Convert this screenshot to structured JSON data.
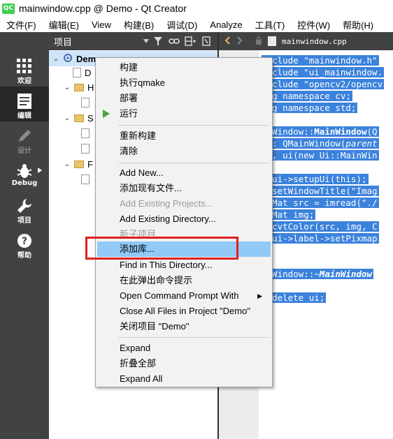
{
  "window": {
    "logo_text": "QC",
    "title": "mainwindow.cpp @ Demo - Qt Creator"
  },
  "menubar": [
    "文件(F)",
    "编辑(E)",
    "View",
    "构建(B)",
    "调试(D)",
    "Analyze",
    "工具(T)",
    "控件(W)",
    "帮助(H)"
  ],
  "modes": [
    {
      "label": "欢迎",
      "icon": "grid-icon"
    },
    {
      "label": "编辑",
      "icon": "edit-document-icon"
    },
    {
      "label": "设计",
      "icon": "pencil-icon"
    },
    {
      "label": "Debug",
      "icon": "bug-icon"
    },
    {
      "label": "项目",
      "icon": "wrench-icon"
    },
    {
      "label": "帮助",
      "icon": "help-icon"
    }
  ],
  "project_pane": {
    "title": "项目"
  },
  "tree": [
    {
      "text": "Demo",
      "type": "project"
    },
    {
      "text": "D",
      "type": "file"
    },
    {
      "text": "H",
      "type": "folder"
    },
    {
      "text": "",
      "type": "file"
    },
    {
      "text": "S",
      "type": "folder"
    },
    {
      "text": "",
      "type": "file"
    },
    {
      "text": "",
      "type": "file"
    },
    {
      "text": "F",
      "type": "folder"
    },
    {
      "text": "",
      "type": "file"
    }
  ],
  "editor": {
    "tab_title": "mainwindow.cpp",
    "lines": [
      "include \"mainwindow.h\"",
      "include \"ui_mainwindow.",
      "include \"opencv2/opencv",
      "ing namespace cv;",
      "ing namespace std;",
      "",
      "inWindow::",
      "  : QMainWindow(",
      "  , ui(new Ui::MainWin",
      "",
      "  ui->setupUi(this);",
      "  setWindowTitle(\"Imag",
      "  Mat src = imread(\"./",
      "  Mat img;",
      "  cvtColor(src, img, C",
      "  ui->label->setPixmap",
      "",
      "inWindow::~",
      "",
      "  delete ui;"
    ],
    "bold_fragments": {
      "line6": "MainWindow",
      "line6_tail": "(Q",
      "line7_italic": "parent",
      "line17": "MainWindow"
    }
  },
  "context_menu": {
    "items": [
      {
        "label": "构建",
        "enabled": true
      },
      {
        "label": "执行qmake",
        "enabled": true
      },
      {
        "label": "部署",
        "enabled": true
      },
      {
        "label": "运行",
        "enabled": true,
        "icon": "run-icon"
      },
      {
        "label": "重新构建",
        "enabled": true
      },
      {
        "label": "清除",
        "enabled": true
      },
      {
        "label": "Add New...",
        "enabled": true
      },
      {
        "label": "添加现有文件...",
        "enabled": true
      },
      {
        "label": "Add Existing Projects...",
        "enabled": false
      },
      {
        "label": "Add Existing Directory...",
        "enabled": true
      },
      {
        "label": "新子项目...",
        "enabled": false
      },
      {
        "label": "添加库...",
        "enabled": true,
        "hover": true
      },
      {
        "label": "Find in This Directory...",
        "enabled": true
      },
      {
        "label": "在此弹出命令提示",
        "enabled": true
      },
      {
        "label": "Open Command Prompt With",
        "enabled": true,
        "submenu": true
      },
      {
        "label": "Close All Files in Project \"Demo\"",
        "enabled": true
      },
      {
        "label": "关闭项目 \"Demo\"",
        "enabled": true
      },
      {
        "label": "Expand",
        "enabled": true
      },
      {
        "label": "折叠全部",
        "enabled": true
      },
      {
        "label": "Expand All",
        "enabled": true
      }
    ]
  },
  "colors": {
    "sidebar": "#404244",
    "selection": "#3b82dc",
    "menu_hover": "#91c9f7",
    "highlight_box": "#e02020",
    "run": "#48a23f"
  }
}
